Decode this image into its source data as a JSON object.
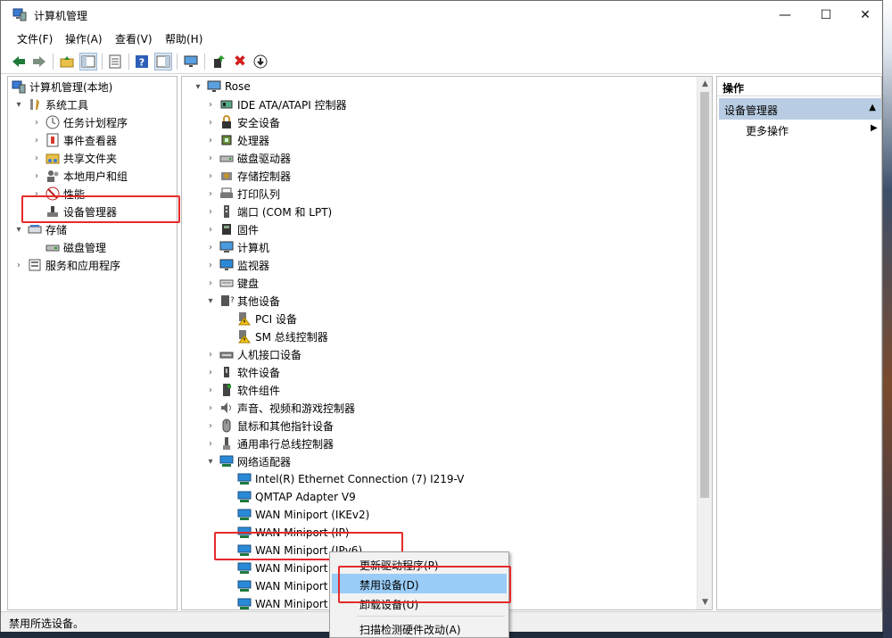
{
  "window": {
    "title": "计算机管理",
    "min_glyph": "—",
    "max_glyph": "☐",
    "close_glyph": "✕"
  },
  "menu": [
    "文件(F)",
    "操作(A)",
    "查看(V)",
    "帮助(H)"
  ],
  "toolbar_icons": [
    "back-icon",
    "forward-icon",
    "up-folder-icon",
    "show-hide-tree-icon",
    "properties-icon",
    "help-icon",
    "show-hide-action-pane-icon",
    "scan-monitor-icon",
    "update-driver-icon",
    "uninstall-icon",
    "disable-device-icon"
  ],
  "left_tree": [
    {
      "label": "计算机管理(本地)",
      "icon": "computer-management-icon",
      "chevron": ""
    },
    {
      "label": "系统工具",
      "icon": "system-tools-icon",
      "chevron": "▾"
    },
    {
      "label": "任务计划程序",
      "icon": "task-scheduler-icon",
      "chevron": "›"
    },
    {
      "label": "事件查看器",
      "icon": "event-viewer-icon",
      "chevron": "›"
    },
    {
      "label": "共享文件夹",
      "icon": "shared-folders-icon",
      "chevron": "›"
    },
    {
      "label": "本地用户和组",
      "icon": "local-users-icon",
      "chevron": "›"
    },
    {
      "label": "性能",
      "icon": "performance-icon",
      "chevron": "›"
    },
    {
      "label": "设备管理器",
      "icon": "device-manager-icon",
      "chevron": ""
    },
    {
      "label": "存储",
      "icon": "storage-icon",
      "chevron": "▾"
    },
    {
      "label": "磁盘管理",
      "icon": "disk-management-icon",
      "chevron": ""
    },
    {
      "label": "服务和应用程序",
      "icon": "services-apps-icon",
      "chevron": "›"
    }
  ],
  "device_tree": [
    {
      "label": "Rose",
      "icon": "computer-root-icon",
      "chevron": "▾",
      "level": 0
    },
    {
      "label": "IDE ATA/ATAPI 控制器",
      "icon": "ide-controller-icon",
      "chevron": "›",
      "level": 1
    },
    {
      "label": "安全设备",
      "icon": "security-device-icon",
      "chevron": "›",
      "level": 1
    },
    {
      "label": "处理器",
      "icon": "processor-icon",
      "chevron": "›",
      "level": 1
    },
    {
      "label": "磁盘驱动器",
      "icon": "disk-drive-icon",
      "chevron": "›",
      "level": 1
    },
    {
      "label": "存储控制器",
      "icon": "storage-controller-icon",
      "chevron": "›",
      "level": 1
    },
    {
      "label": "打印队列",
      "icon": "print-queue-icon",
      "chevron": "›",
      "level": 1
    },
    {
      "label": "端口 (COM 和 LPT)",
      "icon": "port-icon",
      "chevron": "›",
      "level": 1
    },
    {
      "label": "固件",
      "icon": "firmware-icon",
      "chevron": "›",
      "level": 1
    },
    {
      "label": "计算机",
      "icon": "computer-icon",
      "chevron": "›",
      "level": 1
    },
    {
      "label": "监视器",
      "icon": "monitor-icon",
      "chevron": "›",
      "level": 1
    },
    {
      "label": "键盘",
      "icon": "keyboard-icon",
      "chevron": "›",
      "level": 1
    },
    {
      "label": "其他设备",
      "icon": "other-devices-icon",
      "chevron": "▾",
      "level": 1
    },
    {
      "label": "PCI 设备",
      "icon": "warning-device-icon",
      "chevron": "",
      "level": 2
    },
    {
      "label": "SM 总线控制器",
      "icon": "warning-device-icon",
      "chevron": "",
      "level": 2
    },
    {
      "label": "人机接口设备",
      "icon": "hid-icon",
      "chevron": "›",
      "level": 1
    },
    {
      "label": "软件设备",
      "icon": "software-device-icon",
      "chevron": "›",
      "level": 1
    },
    {
      "label": "软件组件",
      "icon": "software-component-icon",
      "chevron": "›",
      "level": 1
    },
    {
      "label": "声音、视频和游戏控制器",
      "icon": "sound-icon",
      "chevron": "›",
      "level": 1
    },
    {
      "label": "鼠标和其他指针设备",
      "icon": "mouse-icon",
      "chevron": "›",
      "level": 1
    },
    {
      "label": "通用串行总线控制器",
      "icon": "usb-icon",
      "chevron": "›",
      "level": 1
    },
    {
      "label": "网络适配器",
      "icon": "network-adapter-icon",
      "chevron": "▾",
      "level": 1
    },
    {
      "label": "Intel(R) Ethernet Connection (7) I219-V",
      "icon": "network-adapter-icon",
      "chevron": "",
      "level": 2
    },
    {
      "label": "QMTAP Adapter V9",
      "icon": "network-adapter-icon",
      "chevron": "",
      "level": 2
    },
    {
      "label": "WAN Miniport (IKEv2)",
      "icon": "network-adapter-icon",
      "chevron": "",
      "level": 2
    },
    {
      "label": "WAN Miniport (IP)",
      "icon": "network-adapter-icon",
      "chevron": "",
      "level": 2
    },
    {
      "label": "WAN Miniport (IPv6)",
      "icon": "network-adapter-icon",
      "chevron": "",
      "level": 2
    },
    {
      "label": "WAN Miniport",
      "icon": "network-adapter-icon",
      "chevron": "",
      "level": 2
    },
    {
      "label": "WAN Miniport",
      "icon": "network-adapter-icon",
      "chevron": "",
      "level": 2
    },
    {
      "label": "WAN Miniport",
      "icon": "network-adapter-icon",
      "chevron": "",
      "level": 2
    }
  ],
  "actions": {
    "header": "操作",
    "group": "设备管理器",
    "group_arrow": "▲",
    "more": "更多操作",
    "more_arrow": "▶"
  },
  "context_menu": [
    {
      "label": "更新驱动程序(P)",
      "highlighted": false
    },
    {
      "label": "禁用设备(D)",
      "highlighted": true
    },
    {
      "label": "卸载设备(U)",
      "highlighted": false
    },
    {
      "label": "扫描检测硬件改动(A)",
      "highlighted": false
    }
  ],
  "status": "禁用所选设备。",
  "colors": {
    "selection": "#99ccf7",
    "annotation_red": "#e52a2a",
    "action_group": "#b8cde3"
  }
}
